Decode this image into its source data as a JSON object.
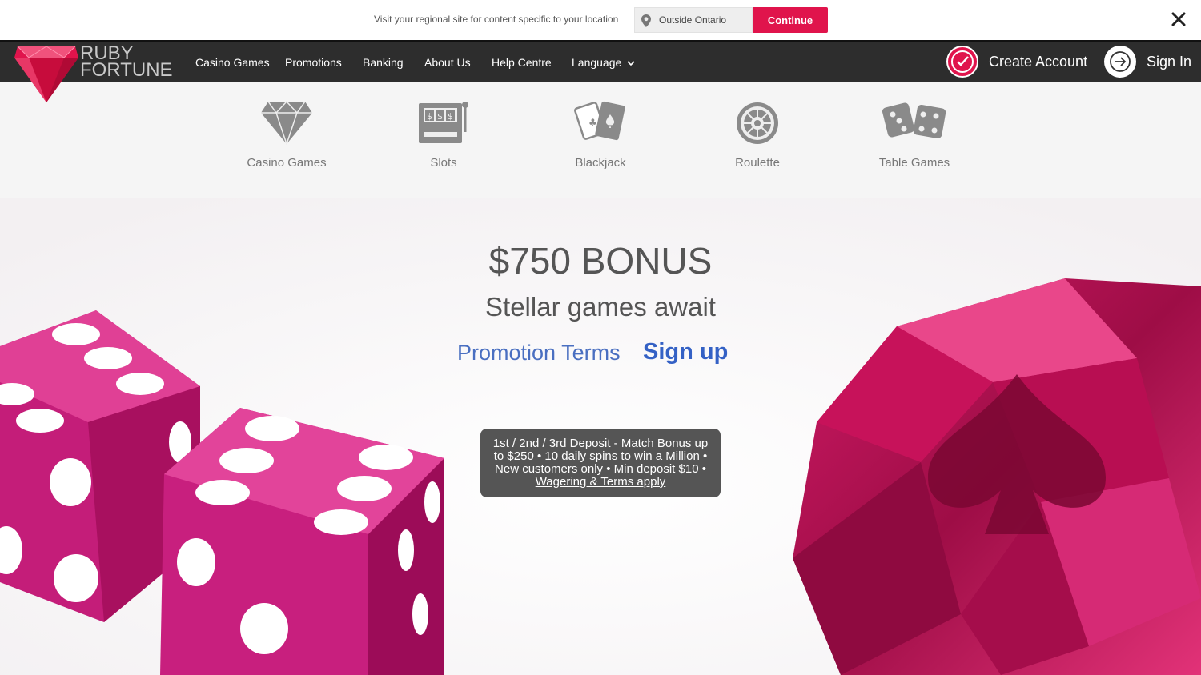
{
  "region_banner": {
    "message": "Visit your regional site for content specific to your location",
    "selected_region": "Outside Ontario",
    "continue_label": "Continue",
    "close_icon": "close-icon"
  },
  "brand": {
    "name_line1": "RUBY",
    "name_line2": "FORTUNE",
    "logo_icon": "ruby-gem-icon",
    "accent_color": "#e0144c"
  },
  "nav": {
    "items": [
      "Casino Games",
      "Promotions",
      "Banking",
      "About Us",
      "Help Centre",
      "Language"
    ],
    "create_account": "Create Account",
    "sign_in": "Sign In"
  },
  "games": [
    {
      "label": "Casino Games",
      "icon": "diamond-icon"
    },
    {
      "label": "Slots",
      "icon": "slot-machine-icon"
    },
    {
      "label": "Blackjack",
      "icon": "cards-icon"
    },
    {
      "label": "Roulette",
      "icon": "roulette-wheel-icon"
    },
    {
      "label": "Table Games",
      "icon": "dice-icon"
    }
  ],
  "hero": {
    "bonus": "$750 BONUS",
    "tagline": "Stellar games await",
    "promotion_terms": "Promotion Terms",
    "sign_up": "Sign up",
    "terms_line": "1st / 2nd / 3rd Deposit - Match Bonus up to $250 • 10 daily spins to win a Million • New customers only • Min deposit $10 •",
    "terms_link": "Wagering & Terms apply"
  }
}
